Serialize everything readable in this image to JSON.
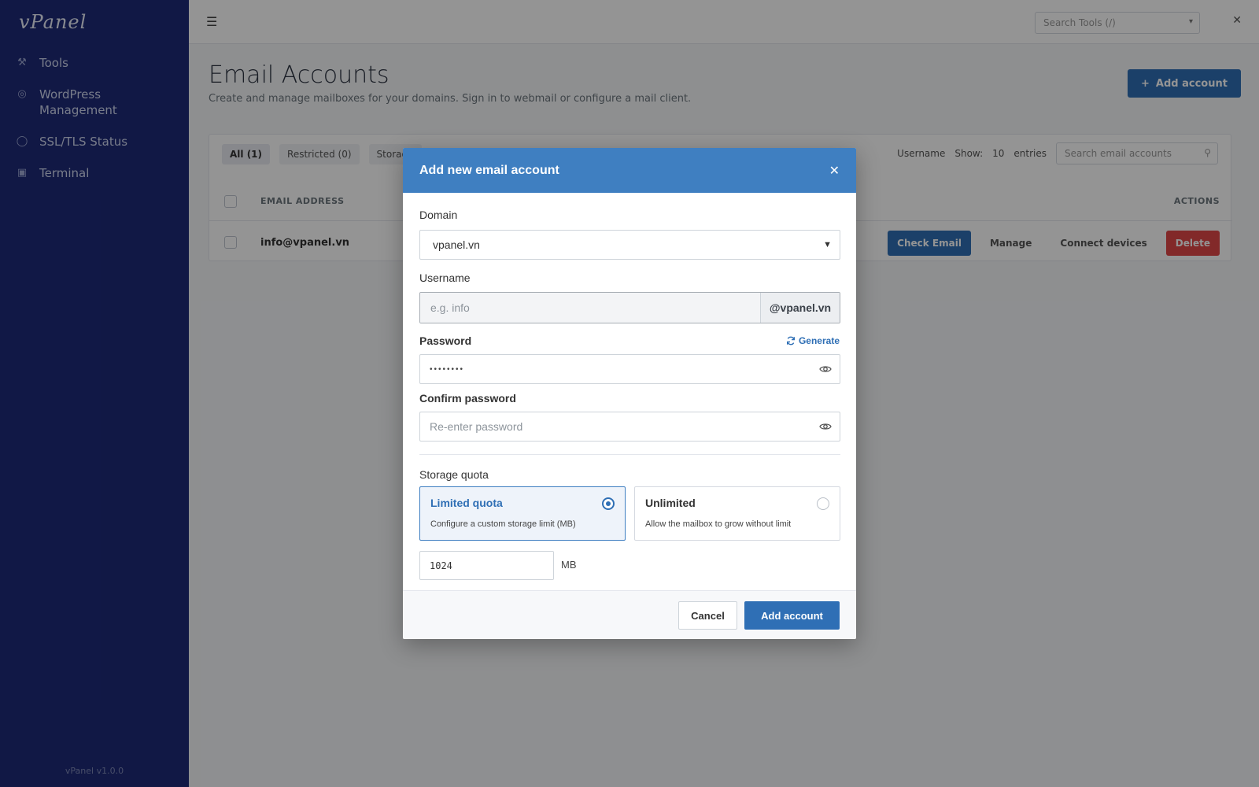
{
  "sidebar": {
    "logo": "vPanel",
    "items": [
      {
        "label": "Tools",
        "icon": "wrench-icon"
      },
      {
        "label": "WordPress Management",
        "icon": "wordpress-icon"
      },
      {
        "label": "SSL/TLS Status",
        "icon": "lock-icon"
      },
      {
        "label": "Terminal",
        "icon": "terminal-icon"
      }
    ],
    "footer": "vPanel v1.0.0"
  },
  "topbar": {
    "search_placeholder": "Search Tools (/)"
  },
  "page": {
    "title": "Email Accounts",
    "subtitle": "Create and manage mailboxes for your domains. Sign in to webmail or configure a mail client.",
    "add_button": "Add account",
    "tabs": [
      "All (1)",
      "Restricted (0)",
      "Storage"
    ],
    "toolbar": {
      "show_label": "Show:",
      "per_page": "10",
      "entries_label": "entries",
      "sort_label": "Username",
      "search_placeholder": "Search email accounts"
    },
    "table": {
      "headers": [
        "EMAIL ADDRESS",
        "ACTIONS"
      ],
      "rows": [
        {
          "email": "info@vpanel.vn",
          "actions": [
            "Check Email",
            "Manage",
            "Connect devices",
            "Delete"
          ]
        }
      ]
    }
  },
  "modal": {
    "title": "Add new email account",
    "close_icon": "close-icon",
    "domain_label": "Domain",
    "domain_value": "vpanel.vn",
    "username_label": "Username",
    "username_placeholder": "e.g. info",
    "username_suffix": "@vpanel.vn",
    "password_label": "Password",
    "generate_label": "Generate",
    "password_mask": "••••••••",
    "confirm_label": "Confirm password",
    "confirm_placeholder": "Re-enter password",
    "quota_label": "Storage quota",
    "quota_options": [
      {
        "title": "Limited quota",
        "desc": "Configure a custom storage limit (MB)",
        "selected": true
      },
      {
        "title": "Unlimited",
        "desc": "Allow the mailbox to grow without limit",
        "selected": false
      }
    ],
    "quota_value": "1024",
    "quota_unit": "MB",
    "cancel_label": "Cancel",
    "submit_label": "Add account"
  },
  "colors": {
    "accent": "#2f6fb5",
    "modal_header": "#3f7fc1",
    "sidebar": "#1e2a78",
    "danger": "#e04848"
  }
}
